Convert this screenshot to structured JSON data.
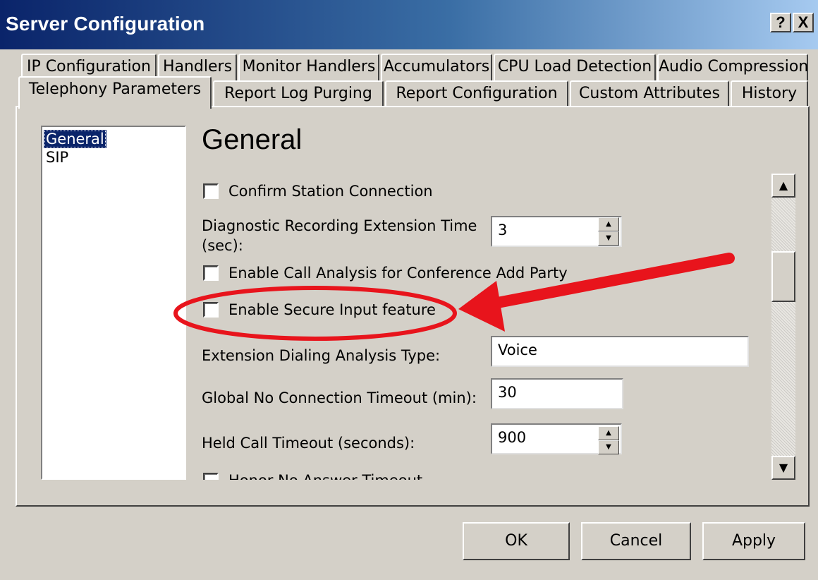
{
  "window": {
    "title": "Server Configuration",
    "help_label": "?",
    "close_label": "X"
  },
  "tabs": {
    "row1": [
      "IP Configuration",
      "Handlers",
      "Monitor Handlers",
      "Accumulators",
      "CPU Load Detection",
      "Audio Compression"
    ],
    "row2": [
      "Telephony Parameters",
      "Report Log Purging",
      "Report Configuration",
      "Custom Attributes",
      "History"
    ],
    "active": "Telephony Parameters"
  },
  "nav": {
    "items": [
      "General",
      "SIP"
    ],
    "selected": "General"
  },
  "general": {
    "title": "General",
    "confirm_station_connection": {
      "label": "Confirm Station Connection",
      "checked": false
    },
    "diagnostic_recording": {
      "label_line1": "Diagnostic Recording Extension Time",
      "label_line2": "(sec):",
      "value": "3"
    },
    "call_analysis_conference": {
      "label": "Enable Call Analysis for Conference Add Party",
      "checked": false
    },
    "secure_input": {
      "label": "Enable Secure Input feature",
      "checked": false
    },
    "extension_dialing": {
      "label": "Extension Dialing Analysis Type:",
      "value": "Voice"
    },
    "global_no_connection": {
      "label": "Global No Connection Timeout (min):",
      "value": "30"
    },
    "held_call_timeout": {
      "label": "Held Call Timeout (seconds):",
      "value": "900"
    },
    "honor_no_answer": {
      "label": "Honor No Answer Timeout",
      "checked": false
    }
  },
  "buttons": {
    "ok": "OK",
    "cancel": "Cancel",
    "apply": "Apply"
  },
  "icons": {
    "scroll_up": "up-arrow-icon",
    "scroll_down": "down-arrow-icon",
    "spin_up": "spin-up-icon",
    "spin_down": "spin-down-icon"
  },
  "colors": {
    "title_bar": "#0a246a",
    "selection": "#0a246a",
    "face": "#d4d0c8",
    "annotation": "#e8141c"
  }
}
